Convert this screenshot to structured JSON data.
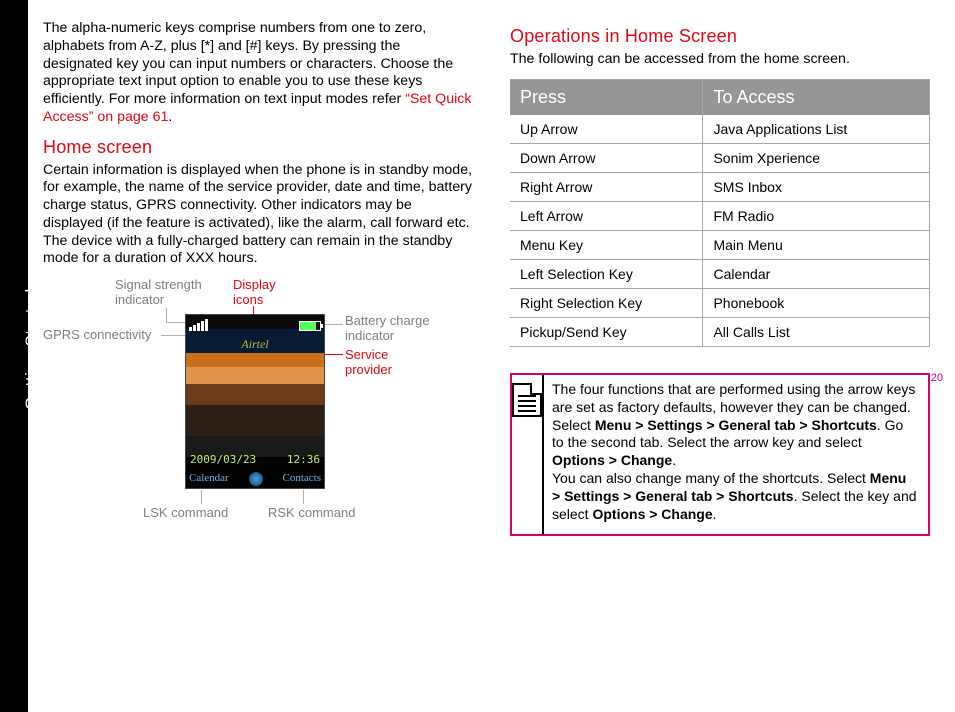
{
  "sidebar_label": "Getting Started",
  "page_number": "20",
  "left": {
    "intro": "The alpha-numeric keys comprise numbers from one to zero, alphabets from A-Z, plus [*] and [#] keys. By pressing the designated key you can input numbers or characters. Choose the appropriate text input option to enable you to use these keys efficiently. For more information on text input modes refer ",
    "intro_link": "“Set Quick Access” on page 61",
    "intro_after": ".",
    "heading1": "Home screen",
    "para1": "Certain information is displayed when the phone is in standby mode, for example, the name of the service provider, date and time, battery charge status, GPRS connectivity. Other indicators may be displayed (if the feature is activated), like the alarm, call forward etc. The device with a fully-charged battery can remain in the standby mode for a duration of XXX hours."
  },
  "diagram": {
    "signal": "Signal strength indicator",
    "display_icons": "Display icons",
    "gprs": "GPRS connectivity",
    "battery": "Battery charge indicator",
    "service": "Service provider",
    "lsk": "LSK command",
    "rsk": "RSK command",
    "provider_text": "Airtel",
    "date": "2009/03/23",
    "time": "12:36",
    "soft_left": "Calendar",
    "soft_right": "Contacts"
  },
  "right": {
    "heading": "Operations in Home Screen",
    "intro": "The following can be accessed from the home screen.",
    "th1": "Press",
    "th2": "To Access",
    "rows": [
      {
        "press": "Up Arrow",
        "access": "Java Applications List"
      },
      {
        "press": "Down Arrow",
        "access": "Sonim Xperience"
      },
      {
        "press": "Right Arrow",
        "access": "SMS Inbox"
      },
      {
        "press": "Left Arrow",
        "access": "FM Radio"
      },
      {
        "press": "Menu  Key",
        "access": "Main Menu"
      },
      {
        "press": "Left Selection Key",
        "access": "Calendar"
      },
      {
        "press": "Right Selection Key",
        "access": "Phonebook"
      },
      {
        "press": "Pickup/Send Key",
        "access": "All Calls List"
      }
    ],
    "note_a": "The four functions that are performed using the arrow keys are set as factory defaults, however they can be changed. Select ",
    "note_b1": "Menu >  Settings > General tab > Shortcuts",
    "note_c": ". Go to the second tab. Select the arrow key and select ",
    "note_b2": "Options > Change",
    "note_d": ".",
    "note_e": "You can also change many of the shortcuts. Select ",
    "note_b3": "Menu >  Settings > General tab > Shortcuts",
    "note_f": ". Select the key and select ",
    "note_b4": "Options > Change",
    "note_g": "."
  }
}
